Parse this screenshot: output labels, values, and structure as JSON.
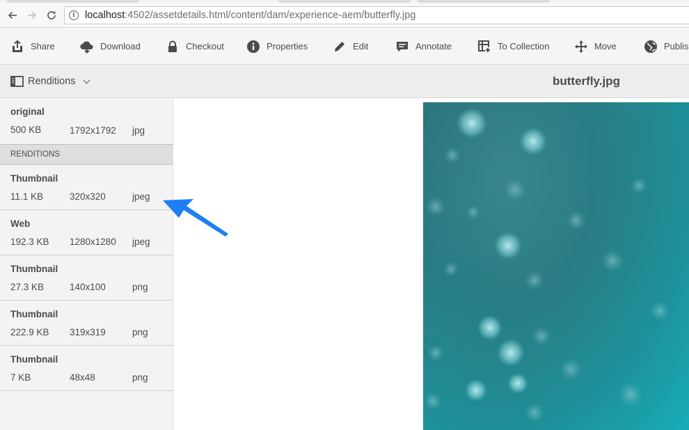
{
  "browser": {
    "url_host": "localhost",
    "url_rest": ":4502/assetdetails.html/content/dam/experience-aem/butterfly.jpg"
  },
  "actions": [
    {
      "label": "Share",
      "icon": "share-icon"
    },
    {
      "label": "Download",
      "icon": "download-icon"
    },
    {
      "label": "Checkout",
      "icon": "lock-icon"
    },
    {
      "label": "Properties",
      "icon": "info-icon"
    },
    {
      "label": "Edit",
      "icon": "pencil-icon"
    },
    {
      "label": "Annotate",
      "icon": "comment-icon"
    },
    {
      "label": "To Collection",
      "icon": "collection-add-icon"
    },
    {
      "label": "Move",
      "icon": "move-icon"
    },
    {
      "label": "Publish",
      "icon": "globe-icon"
    }
  ],
  "subheader": {
    "rail_label": "Renditions",
    "asset_title": "butterfly.jpg"
  },
  "original": {
    "name": "original",
    "size": "500 KB",
    "dims": "1792x1792",
    "type": "jpg"
  },
  "renditions_heading": "RENDITIONS",
  "renditions": [
    {
      "name": "Thumbnail",
      "size": "11.1 KB",
      "dims": "320x320",
      "type": "jpeg"
    },
    {
      "name": "Web",
      "size": "192.3 KB",
      "dims": "1280x1280",
      "type": "jpeg"
    },
    {
      "name": "Thumbnail",
      "size": "27.3 KB",
      "dims": "140x100",
      "type": "png"
    },
    {
      "name": "Thumbnail",
      "size": "222.9 KB",
      "dims": "319x319",
      "type": "png"
    },
    {
      "name": "Thumbnail",
      "size": "7 KB",
      "dims": "48x48",
      "type": "png"
    }
  ],
  "colors": {
    "annotation_arrow": "#1f7ef2",
    "photo_teal": "#1aa9b4"
  }
}
